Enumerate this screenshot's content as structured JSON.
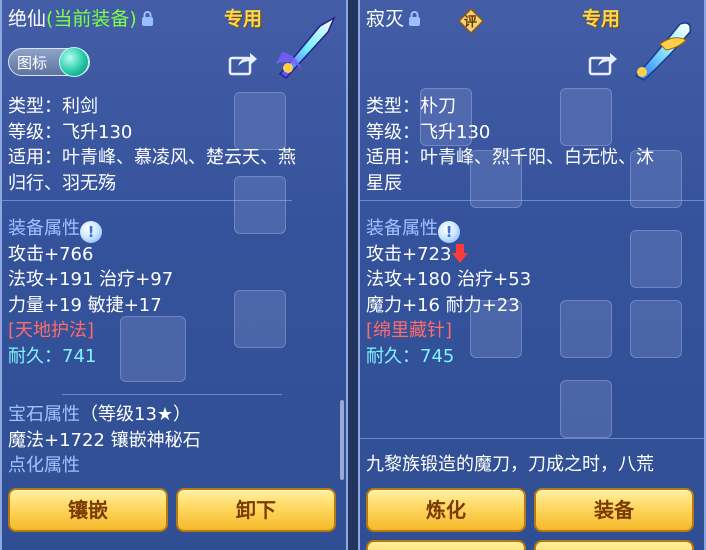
{
  "left": {
    "name": "绝仙",
    "equipped_tag": "(当前装备)",
    "exclusive": "专用",
    "icon_toggle": "图标",
    "stats": [
      {
        "text": "类型：利剑",
        "style": "white"
      },
      {
        "text": "等级：飞升130",
        "style": "white"
      },
      {
        "text": "适用：叶青峰、慕凌风、楚云天、燕",
        "style": "white"
      },
      {
        "text": "归行、羽无殇",
        "style": "white"
      }
    ],
    "equip_attr_title": "装备属性",
    "attrs": [
      {
        "text": "攻击+766"
      },
      {
        "text": "法攻+191 治疗+97"
      },
      {
        "text": "力量+19 敏捷+17"
      }
    ],
    "special": "[天地护法]",
    "durability": "耐久：741",
    "gem_title": "宝石属性",
    "gem_level": "（等级13★）",
    "gem_attr": "魔法+1722 镶嵌神秘石",
    "refine_title": "点化属性",
    "buttons": [
      "镶嵌",
      "卸下"
    ]
  },
  "right": {
    "name": "寂灭",
    "rate_badge": "评",
    "exclusive": "专用",
    "stats": [
      {
        "text": "类型：朴刀"
      },
      {
        "text": "等级：飞升130"
      },
      {
        "text": "适用：叶青峰、烈千阳、白无忧、沐"
      },
      {
        "text": "星辰"
      }
    ],
    "equip_attr_title": "装备属性",
    "attack": "攻击+723",
    "attrs": [
      {
        "text": "法攻+180 治疗+53"
      },
      {
        "text": "魔力+16 耐力+23"
      }
    ],
    "special": "[绵里藏针]",
    "durability": "耐久：745",
    "desc": "九黎族锻造的魔刀，刀成之时，八荒",
    "buttons": [
      "炼化",
      "装备"
    ]
  },
  "colors": {
    "equipped": "#7bff4a",
    "exclusive": "#ffd84a",
    "section": "#9fc3ff",
    "special": "#ff6b6b",
    "durability": "#7ff3ff"
  }
}
